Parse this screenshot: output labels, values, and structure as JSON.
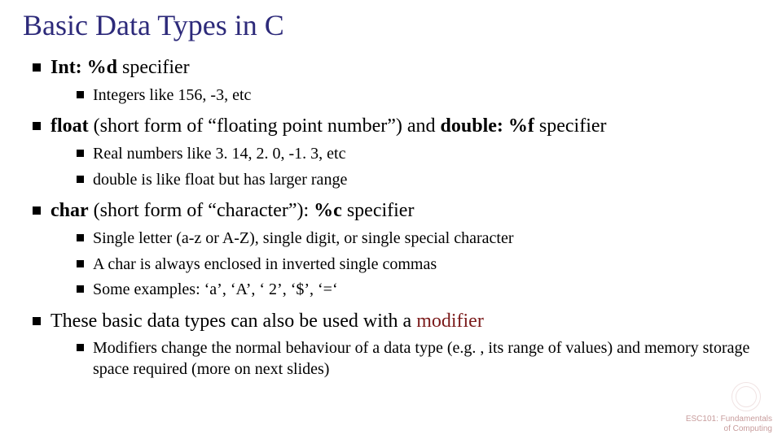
{
  "title": "Basic Data Types in C",
  "items": [
    {
      "runs": [
        {
          "t": "Int: %d",
          "b": true
        },
        {
          "t": " specifier"
        }
      ],
      "sub": [
        [
          {
            "t": "Integers like 156, -3, etc"
          }
        ]
      ]
    },
    {
      "runs": [
        {
          "t": "float",
          "b": true
        },
        {
          "t": " (short form of “floating point number”) and "
        },
        {
          "t": "double: %f",
          "b": true
        },
        {
          "t": " specifier"
        }
      ],
      "sub": [
        [
          {
            "t": "Real numbers like 3. 14, 2. 0, -1. 3, etc"
          }
        ],
        [
          {
            "t": "double is like float but has larger range"
          }
        ]
      ]
    },
    {
      "runs": [
        {
          "t": "char",
          "b": true
        },
        {
          "t": " (short form of “character”): "
        },
        {
          "t": "%c",
          "b": true
        },
        {
          "t": " specifier"
        }
      ],
      "sub": [
        [
          {
            "t": "Single letter (a-z or A-Z), single digit, or single special character"
          }
        ],
        [
          {
            "t": "A char is always enclosed in inverted single commas"
          }
        ],
        [
          {
            "t": "Some examples: ‘a’, ‘A’, ‘ 2’, ‘$’, ‘=‘"
          }
        ]
      ]
    },
    {
      "runs": [
        {
          "t": "These basic data types can also be used with a "
        },
        {
          "t": "modifier",
          "accent": true
        }
      ],
      "sub": [
        [
          {
            "t": "Modifiers change the normal behaviour of a data type (e.g. , its range of values) and memory storage space required (more on next slides)"
          }
        ]
      ]
    }
  ],
  "footer": {
    "line1": "ESC101: Fundamentals",
    "line2": "of Computing"
  }
}
